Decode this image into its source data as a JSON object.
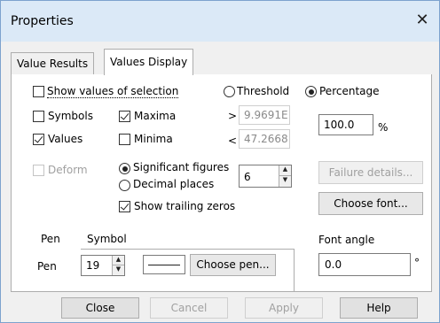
{
  "window": {
    "title": "Properties"
  },
  "tabs": [
    {
      "label": "Value Results"
    },
    {
      "label": "Values Display"
    }
  ],
  "display": {
    "show_values": "Show values of selection",
    "threshold": "Threshold",
    "percentage": "Percentage",
    "symbols": "Symbols",
    "maxima": "Maxima",
    "values": "Values",
    "minima": "Minima",
    "gt": ">",
    "lt": "<",
    "max_value": "9.9691E",
    "min_value": "47.2668",
    "percent_value": "100.0",
    "percent_unit": "%",
    "deform": "Deform",
    "sig_figs": "Significant figures",
    "decimal_places": "Decimal places",
    "digits_value": "6",
    "trailing_zeros": "Show trailing zeros",
    "failure_details": "Failure details...",
    "choose_font": "Choose font...",
    "font_angle_label": "Font angle",
    "font_angle_value": "0.0",
    "degree": "°"
  },
  "subtabs": [
    {
      "label": "Pen"
    },
    {
      "label": "Symbol"
    }
  ],
  "pen": {
    "label": "Pen",
    "width_value": "19",
    "choose_pen": "Choose pen..."
  },
  "footer": {
    "close": "Close",
    "cancel": "Cancel",
    "apply": "Apply",
    "help": "Help"
  },
  "icons": {
    "close": "close-icon",
    "spin_up": "chevron-up-icon",
    "spin_down": "chevron-down-icon"
  },
  "colors": {
    "titlebar": "#dbe9f7",
    "dialog_bg": "#f0f0f0",
    "panel_bg": "#ffffff"
  },
  "state": {
    "show_values_checked": false,
    "threshold_selected": false,
    "percentage_selected": true,
    "symbols_checked": false,
    "maxima_checked": true,
    "values_checked": true,
    "minima_checked": false,
    "deform_checked": false,
    "sig_figs_selected": true,
    "decimal_places_selected": false,
    "trailing_zeros_checked": true
  }
}
